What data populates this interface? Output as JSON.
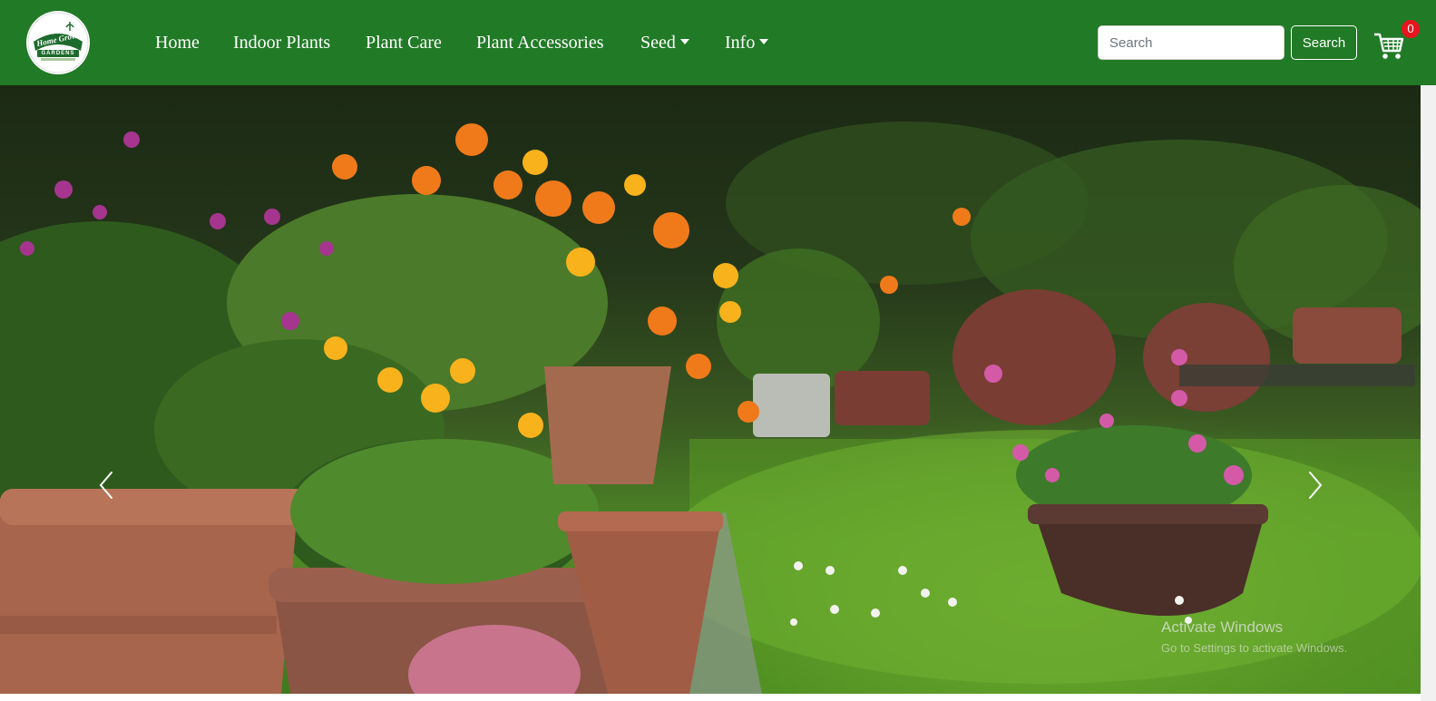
{
  "navbar": {
    "brand": {
      "logo_text": "Home Grown",
      "logo_subtext": "GARDENS"
    },
    "links": [
      {
        "label": "Home"
      },
      {
        "label": "Indoor Plants"
      },
      {
        "label": "Plant Care"
      },
      {
        "label": "Plant Accessories"
      },
      {
        "label": "Seed",
        "dropdown": true
      },
      {
        "label": "Info",
        "dropdown": true
      }
    ],
    "search": {
      "placeholder": "Search",
      "value": "",
      "button_label": "Search"
    },
    "cart": {
      "icon": "cart-icon",
      "count": "0"
    }
  },
  "hero": {
    "image": "garden-potted-flowers",
    "prev_icon": "chevron-left-icon",
    "next_icon": "chevron-right-icon"
  },
  "watermark": {
    "title": "Activate Windows",
    "subtitle": "Go to Settings to activate Windows."
  },
  "colors": {
    "navbar_bg": "#217a26",
    "badge_bg": "#e8141f",
    "link_text": "#ffffff"
  }
}
